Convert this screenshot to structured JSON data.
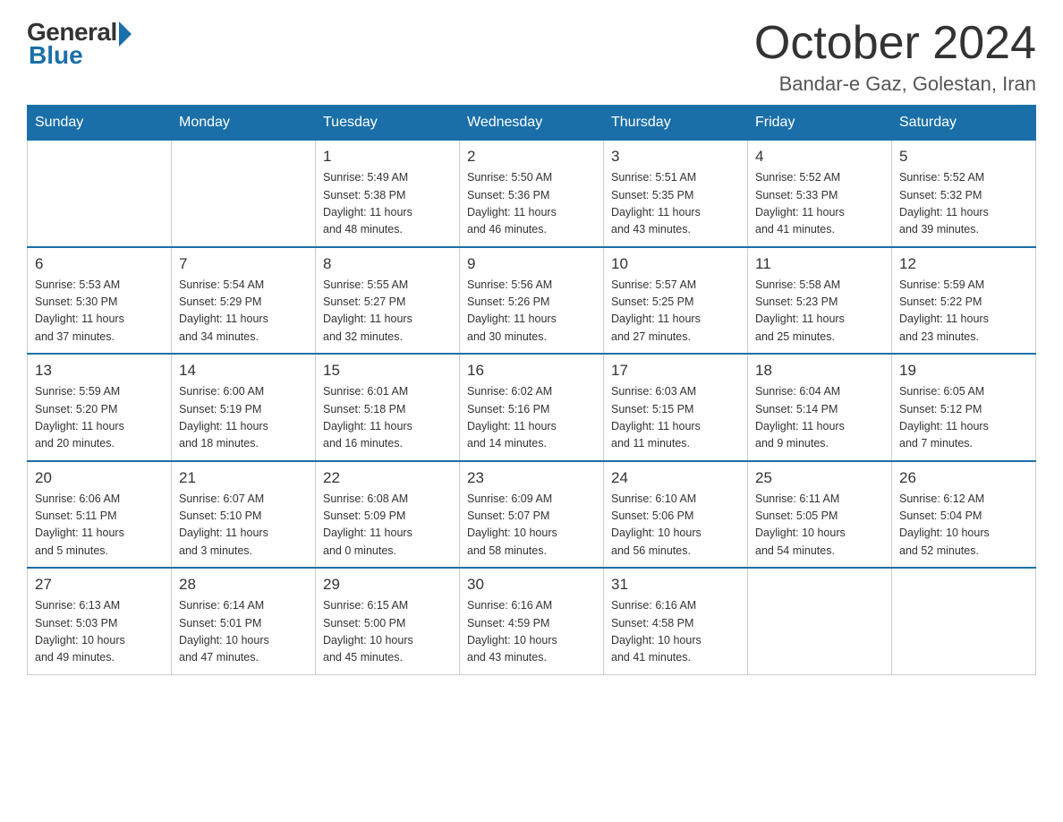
{
  "logo": {
    "general": "General",
    "blue": "Blue"
  },
  "title": "October 2024",
  "location": "Bandar-e Gaz, Golestan, Iran",
  "weekdays": [
    "Sunday",
    "Monday",
    "Tuesday",
    "Wednesday",
    "Thursday",
    "Friday",
    "Saturday"
  ],
  "weeks": [
    [
      {
        "day": "",
        "info": ""
      },
      {
        "day": "",
        "info": ""
      },
      {
        "day": "1",
        "info": "Sunrise: 5:49 AM\nSunset: 5:38 PM\nDaylight: 11 hours\nand 48 minutes."
      },
      {
        "day": "2",
        "info": "Sunrise: 5:50 AM\nSunset: 5:36 PM\nDaylight: 11 hours\nand 46 minutes."
      },
      {
        "day": "3",
        "info": "Sunrise: 5:51 AM\nSunset: 5:35 PM\nDaylight: 11 hours\nand 43 minutes."
      },
      {
        "day": "4",
        "info": "Sunrise: 5:52 AM\nSunset: 5:33 PM\nDaylight: 11 hours\nand 41 minutes."
      },
      {
        "day": "5",
        "info": "Sunrise: 5:52 AM\nSunset: 5:32 PM\nDaylight: 11 hours\nand 39 minutes."
      }
    ],
    [
      {
        "day": "6",
        "info": "Sunrise: 5:53 AM\nSunset: 5:30 PM\nDaylight: 11 hours\nand 37 minutes."
      },
      {
        "day": "7",
        "info": "Sunrise: 5:54 AM\nSunset: 5:29 PM\nDaylight: 11 hours\nand 34 minutes."
      },
      {
        "day": "8",
        "info": "Sunrise: 5:55 AM\nSunset: 5:27 PM\nDaylight: 11 hours\nand 32 minutes."
      },
      {
        "day": "9",
        "info": "Sunrise: 5:56 AM\nSunset: 5:26 PM\nDaylight: 11 hours\nand 30 minutes."
      },
      {
        "day": "10",
        "info": "Sunrise: 5:57 AM\nSunset: 5:25 PM\nDaylight: 11 hours\nand 27 minutes."
      },
      {
        "day": "11",
        "info": "Sunrise: 5:58 AM\nSunset: 5:23 PM\nDaylight: 11 hours\nand 25 minutes."
      },
      {
        "day": "12",
        "info": "Sunrise: 5:59 AM\nSunset: 5:22 PM\nDaylight: 11 hours\nand 23 minutes."
      }
    ],
    [
      {
        "day": "13",
        "info": "Sunrise: 5:59 AM\nSunset: 5:20 PM\nDaylight: 11 hours\nand 20 minutes."
      },
      {
        "day": "14",
        "info": "Sunrise: 6:00 AM\nSunset: 5:19 PM\nDaylight: 11 hours\nand 18 minutes."
      },
      {
        "day": "15",
        "info": "Sunrise: 6:01 AM\nSunset: 5:18 PM\nDaylight: 11 hours\nand 16 minutes."
      },
      {
        "day": "16",
        "info": "Sunrise: 6:02 AM\nSunset: 5:16 PM\nDaylight: 11 hours\nand 14 minutes."
      },
      {
        "day": "17",
        "info": "Sunrise: 6:03 AM\nSunset: 5:15 PM\nDaylight: 11 hours\nand 11 minutes."
      },
      {
        "day": "18",
        "info": "Sunrise: 6:04 AM\nSunset: 5:14 PM\nDaylight: 11 hours\nand 9 minutes."
      },
      {
        "day": "19",
        "info": "Sunrise: 6:05 AM\nSunset: 5:12 PM\nDaylight: 11 hours\nand 7 minutes."
      }
    ],
    [
      {
        "day": "20",
        "info": "Sunrise: 6:06 AM\nSunset: 5:11 PM\nDaylight: 11 hours\nand 5 minutes."
      },
      {
        "day": "21",
        "info": "Sunrise: 6:07 AM\nSunset: 5:10 PM\nDaylight: 11 hours\nand 3 minutes."
      },
      {
        "day": "22",
        "info": "Sunrise: 6:08 AM\nSunset: 5:09 PM\nDaylight: 11 hours\nand 0 minutes."
      },
      {
        "day": "23",
        "info": "Sunrise: 6:09 AM\nSunset: 5:07 PM\nDaylight: 10 hours\nand 58 minutes."
      },
      {
        "day": "24",
        "info": "Sunrise: 6:10 AM\nSunset: 5:06 PM\nDaylight: 10 hours\nand 56 minutes."
      },
      {
        "day": "25",
        "info": "Sunrise: 6:11 AM\nSunset: 5:05 PM\nDaylight: 10 hours\nand 54 minutes."
      },
      {
        "day": "26",
        "info": "Sunrise: 6:12 AM\nSunset: 5:04 PM\nDaylight: 10 hours\nand 52 minutes."
      }
    ],
    [
      {
        "day": "27",
        "info": "Sunrise: 6:13 AM\nSunset: 5:03 PM\nDaylight: 10 hours\nand 49 minutes."
      },
      {
        "day": "28",
        "info": "Sunrise: 6:14 AM\nSunset: 5:01 PM\nDaylight: 10 hours\nand 47 minutes."
      },
      {
        "day": "29",
        "info": "Sunrise: 6:15 AM\nSunset: 5:00 PM\nDaylight: 10 hours\nand 45 minutes."
      },
      {
        "day": "30",
        "info": "Sunrise: 6:16 AM\nSunset: 4:59 PM\nDaylight: 10 hours\nand 43 minutes."
      },
      {
        "day": "31",
        "info": "Sunrise: 6:16 AM\nSunset: 4:58 PM\nDaylight: 10 hours\nand 41 minutes."
      },
      {
        "day": "",
        "info": ""
      },
      {
        "day": "",
        "info": ""
      }
    ]
  ]
}
